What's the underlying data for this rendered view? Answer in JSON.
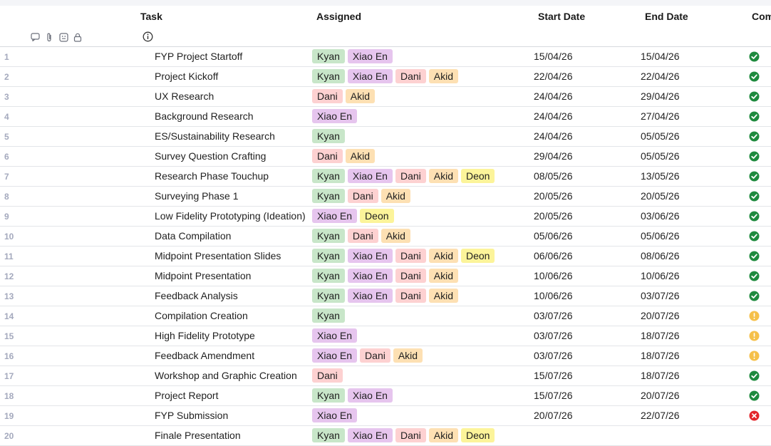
{
  "header": {
    "task": "Task",
    "assigned": "Assigned",
    "start_date": "Start Date",
    "end_date": "End Date",
    "complete": "Com",
    "icons": [
      "comment-icon",
      "paperclip-icon",
      "proof-icon",
      "lock-icon"
    ],
    "info_icon": "info-icon"
  },
  "colors": {
    "Kyan": "#c8e6c9",
    "Xiao En": "#e6c5ee",
    "Dani": "#fdd1d1",
    "Akid": "#fde0b3",
    "Deon": "#fcf49a",
    "complete": "#1e8a3e",
    "warning": "#f5c04a",
    "error": "#e3262b"
  },
  "rows": [
    {
      "num": "1",
      "task": "FYP Project Startoff",
      "assigned": [
        "Kyan",
        "Xiao En"
      ],
      "start": "15/04/26",
      "end": "15/04/26",
      "status": "complete"
    },
    {
      "num": "2",
      "task": "Project Kickoff",
      "assigned": [
        "Kyan",
        "Xiao En",
        "Dani",
        "Akid"
      ],
      "start": "22/04/26",
      "end": "22/04/26",
      "status": "complete"
    },
    {
      "num": "3",
      "task": "UX Research",
      "assigned": [
        "Dani",
        "Akid"
      ],
      "start": "24/04/26",
      "end": "29/04/26",
      "status": "complete"
    },
    {
      "num": "4",
      "task": "Background Research",
      "assigned": [
        "Xiao En"
      ],
      "start": "24/04/26",
      "end": "27/04/26",
      "status": "complete"
    },
    {
      "num": "5",
      "task": "ES/Sustainability Research",
      "assigned": [
        "Kyan"
      ],
      "start": "24/04/26",
      "end": "05/05/26",
      "status": "complete"
    },
    {
      "num": "6",
      "task": "Survey Question Crafting",
      "assigned": [
        "Dani",
        "Akid"
      ],
      "start": "29/04/26",
      "end": "05/05/26",
      "status": "complete"
    },
    {
      "num": "7",
      "task": "Research Phase Touchup",
      "assigned": [
        "Kyan",
        "Xiao En",
        "Dani",
        "Akid",
        "Deon"
      ],
      "start": "08/05/26",
      "end": "13/05/26",
      "status": "complete"
    },
    {
      "num": "8",
      "task": "Surveying Phase 1",
      "assigned": [
        "Kyan",
        "Dani",
        "Akid"
      ],
      "start": "20/05/26",
      "end": "20/05/26",
      "status": "complete"
    },
    {
      "num": "9",
      "task": "Low Fidelity Prototyping (Ideation)",
      "assigned": [
        "Xiao En",
        "Deon"
      ],
      "start": "20/05/26",
      "end": "03/06/26",
      "status": "complete"
    },
    {
      "num": "10",
      "task": "Data Compilation",
      "assigned": [
        "Kyan",
        "Dani",
        "Akid"
      ],
      "start": "05/06/26",
      "end": "05/06/26",
      "status": "complete"
    },
    {
      "num": "11",
      "task": "Midpoint Presentation Slides",
      "assigned": [
        "Kyan",
        "Xiao En",
        "Dani",
        "Akid",
        "Deon"
      ],
      "start": "06/06/26",
      "end": "08/06/26",
      "status": "complete"
    },
    {
      "num": "12",
      "task": "Midpoint Presentation",
      "assigned": [
        "Kyan",
        "Xiao En",
        "Dani",
        "Akid"
      ],
      "start": "10/06/26",
      "end": "10/06/26",
      "status": "complete"
    },
    {
      "num": "13",
      "task": "Feedback Analysis",
      "assigned": [
        "Kyan",
        "Xiao En",
        "Dani",
        "Akid"
      ],
      "start": "10/06/26",
      "end": "03/07/26",
      "status": "complete"
    },
    {
      "num": "14",
      "task": "Compilation Creation",
      "assigned": [
        "Kyan"
      ],
      "start": "03/07/26",
      "end": "20/07/26",
      "status": "warning"
    },
    {
      "num": "15",
      "task": "High Fidelity Prototype",
      "assigned": [
        "Xiao En"
      ],
      "start": "03/07/26",
      "end": "18/07/26",
      "status": "warning"
    },
    {
      "num": "16",
      "task": "Feedback Amendment",
      "assigned": [
        "Xiao En",
        "Dani",
        "Akid"
      ],
      "start": "03/07/26",
      "end": "18/07/26",
      "status": "warning"
    },
    {
      "num": "17",
      "task": "Workshop and Graphic Creation",
      "assigned": [
        "Dani"
      ],
      "start": "15/07/26",
      "end": "18/07/26",
      "status": "complete"
    },
    {
      "num": "18",
      "task": "Project Report",
      "assigned": [
        "Kyan",
        "Xiao En"
      ],
      "start": "15/07/26",
      "end": "20/07/26",
      "status": "complete"
    },
    {
      "num": "19",
      "task": "FYP Submission",
      "assigned": [
        "Xiao En"
      ],
      "start": "20/07/26",
      "end": "22/07/26",
      "status": "error"
    },
    {
      "num": "20",
      "task": "Finale Presentation",
      "assigned": [
        "Kyan",
        "Xiao En",
        "Dani",
        "Akid",
        "Deon"
      ],
      "start": "",
      "end": "",
      "status": "none"
    }
  ]
}
